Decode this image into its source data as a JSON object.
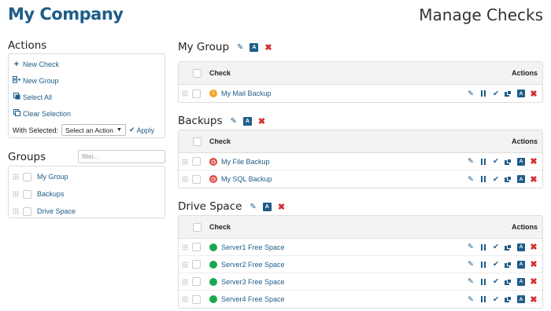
{
  "header": {
    "brand": "My Company",
    "title": "Manage Checks"
  },
  "actions": {
    "title": "Actions",
    "items": [
      {
        "label": "New Check",
        "icon": "plus-icon"
      },
      {
        "label": "New Group",
        "icon": "new-group-icon"
      },
      {
        "label": "Select All",
        "icon": "select-all-icon"
      },
      {
        "label": "Clear Selection",
        "icon": "clear-selection-icon"
      }
    ],
    "with_selected_label": "With Selected:",
    "select_value": "Select an Action",
    "apply_label": "Apply"
  },
  "groups": {
    "title": "Groups",
    "filter_placeholder": "filter...",
    "items": [
      "My Group",
      "Backups",
      "Drive Space"
    ]
  },
  "table_headers": {
    "check": "Check",
    "actions": "Actions"
  },
  "check_groups": [
    {
      "name": "My Group",
      "checks": [
        {
          "name": "My Mail Backup",
          "status": "warning"
        }
      ]
    },
    {
      "name": "Backups",
      "checks": [
        {
          "name": "My File Backup",
          "status": "alert"
        },
        {
          "name": "My SQL Backup",
          "status": "alert"
        }
      ]
    },
    {
      "name": "Drive Space",
      "checks": [
        {
          "name": "Server1 Free Space",
          "status": "ok"
        },
        {
          "name": "Server2 Free Space",
          "status": "ok"
        },
        {
          "name": "Server3 Free Space",
          "status": "ok"
        },
        {
          "name": "Server4 Free Space",
          "status": "ok"
        }
      ]
    }
  ],
  "colors": {
    "brand": "#1e5d88",
    "danger": "#d32f2f",
    "warning": "#f5a524",
    "alert": "#d9423a",
    "ok": "#1aa852"
  }
}
